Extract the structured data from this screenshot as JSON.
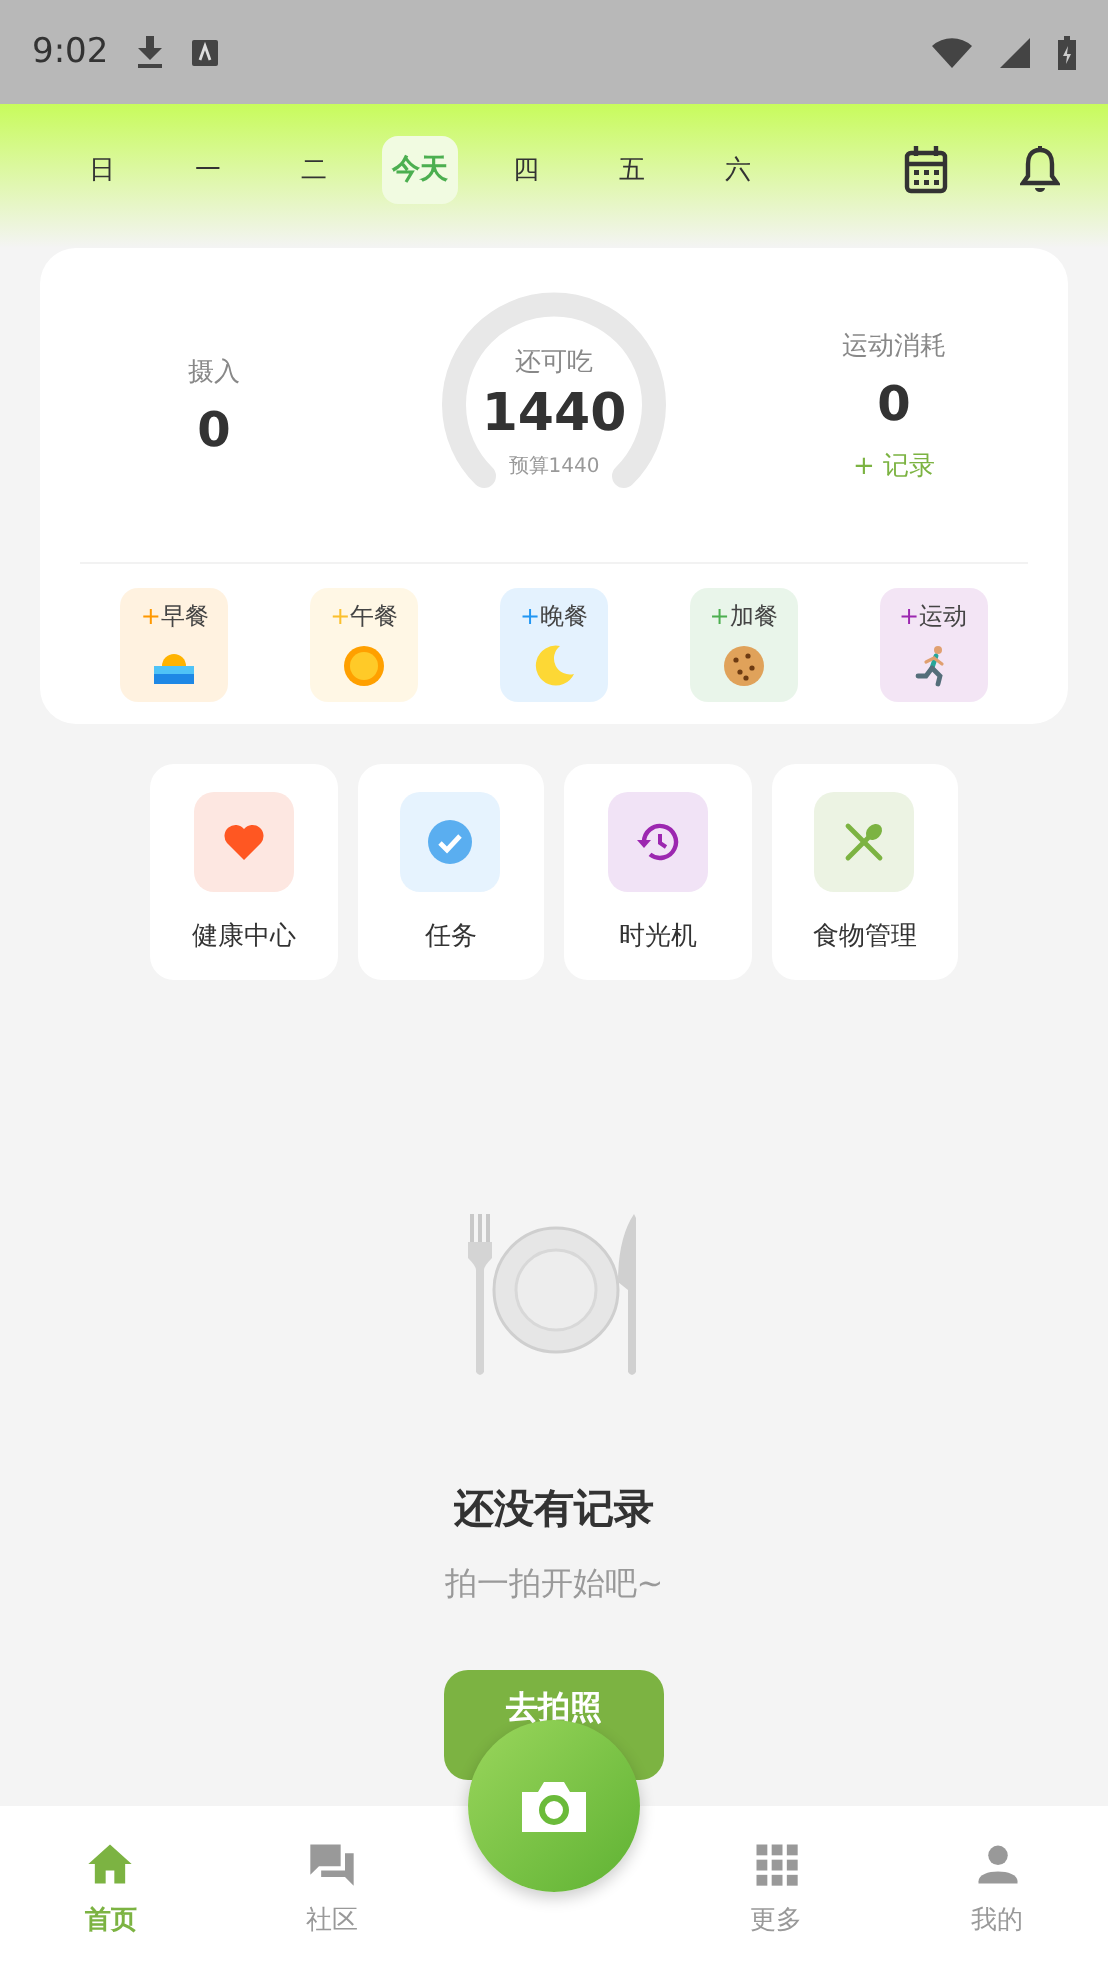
{
  "status_bar": {
    "time": "9:02"
  },
  "week": [
    {
      "label": "日",
      "selected": false
    },
    {
      "label": "一",
      "selected": false
    },
    {
      "label": "二",
      "selected": false
    },
    {
      "label": "今天",
      "selected": true
    },
    {
      "label": "四",
      "selected": false
    },
    {
      "label": "五",
      "selected": false
    },
    {
      "label": "六",
      "selected": false
    }
  ],
  "summary": {
    "intake_label": "摄入",
    "intake_value": "0",
    "remaining_label": "还可吃",
    "remaining_value": "1440",
    "budget": "预算1440",
    "exercise_label": "运动消耗",
    "exercise_value": "0",
    "record_link": "+ 记录"
  },
  "meals": [
    {
      "kind": "breakfast",
      "plus": "+",
      "label": "早餐",
      "color": "#ff9800"
    },
    {
      "kind": "lunch",
      "plus": "+",
      "label": "午餐",
      "color": "#fbc02d"
    },
    {
      "kind": "dinner",
      "plus": "+",
      "label": "晚餐",
      "color": "#2196f3"
    },
    {
      "kind": "snack",
      "plus": "+",
      "label": "加餐",
      "color": "#4caf50"
    },
    {
      "kind": "exercise",
      "plus": "+",
      "label": "运动",
      "color": "#9c27b0"
    }
  ],
  "shortcuts": [
    {
      "kind": "health",
      "label": "健康中心"
    },
    {
      "kind": "tasks",
      "label": "任务"
    },
    {
      "kind": "history",
      "label": "时光机"
    },
    {
      "kind": "food",
      "label": "食物管理"
    }
  ],
  "empty_state": {
    "title": "还没有记录",
    "subtitle": "拍一拍开始吧~",
    "button": "去拍照"
  },
  "bottom_nav": [
    {
      "kind": "home",
      "label": "首页",
      "selected": true
    },
    {
      "kind": "community",
      "label": "社区",
      "selected": false
    },
    {
      "kind": "camera"
    },
    {
      "kind": "more",
      "label": "更多",
      "selected": false
    },
    {
      "kind": "profile",
      "label": "我的",
      "selected": false
    }
  ]
}
